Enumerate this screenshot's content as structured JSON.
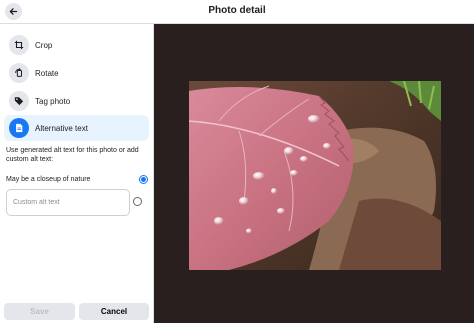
{
  "header": {
    "title": "Photo detail",
    "back_icon": "arrow-left-icon"
  },
  "sidebar": {
    "items": [
      {
        "label": "Crop",
        "icon": "crop-icon",
        "active": false
      },
      {
        "label": "Rotate",
        "icon": "rotate-icon",
        "active": false
      },
      {
        "label": "Tag photo",
        "icon": "tag-icon",
        "active": false
      },
      {
        "label": "Alternative text",
        "icon": "alt-text-icon",
        "active": true
      }
    ]
  },
  "alt_text": {
    "description": "Use generated alt text for this photo or add custom alt text:",
    "generated_option": "May be a closeup of nature",
    "generated_selected": true,
    "custom_placeholder": "Custom alt text",
    "custom_value": ""
  },
  "actions": {
    "save_label": "Save",
    "cancel_label": "Cancel"
  },
  "colors": {
    "accent": "#1877f2",
    "active_bg": "#e7f3ff",
    "viewer_bg": "#2a1f1f"
  }
}
